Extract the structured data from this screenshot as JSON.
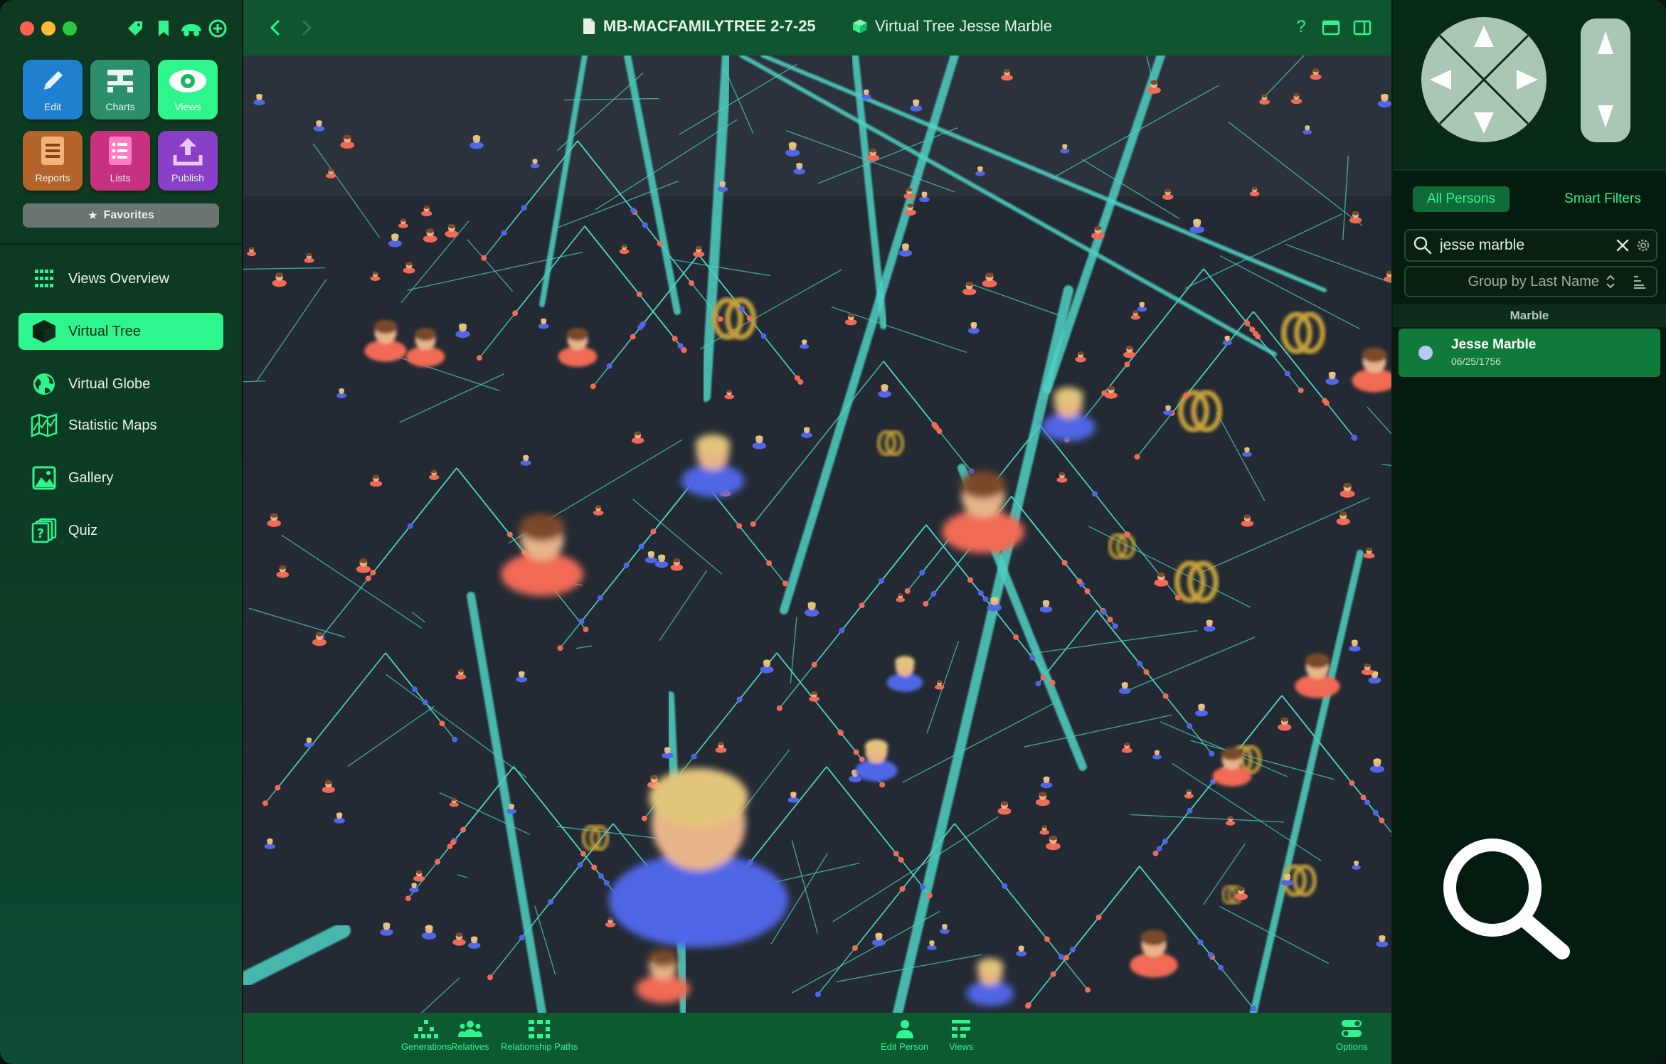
{
  "sidebar": {
    "tools": [
      {
        "label": "Edit",
        "icon": "pencil-icon",
        "color": "#1f7fd0"
      },
      {
        "label": "Charts",
        "icon": "charts-icon",
        "color": "#2b8f6b"
      },
      {
        "label": "Views",
        "icon": "eye-icon",
        "color": "#2ff58d"
      },
      {
        "label": "Reports",
        "icon": "report-icon",
        "color": "#b3642a"
      },
      {
        "label": "Lists",
        "icon": "list-icon",
        "color": "#c7327f"
      },
      {
        "label": "Publish",
        "icon": "publish-icon",
        "color": "#8a3fc9"
      }
    ],
    "favorites_label": "Favorites",
    "nav": [
      {
        "label": "Views Overview",
        "icon": "grid-icon"
      },
      {
        "label": "Virtual Tree",
        "icon": "cube-icon",
        "active": true
      },
      {
        "label": "Virtual Globe",
        "icon": "globe-icon"
      },
      {
        "label": "Statistic Maps",
        "icon": "map-icon"
      },
      {
        "label": "Gallery",
        "icon": "gallery-icon"
      },
      {
        "label": "Quiz",
        "icon": "quiz-icon"
      }
    ]
  },
  "titlebar": {
    "document": "MB-MACFAMILYTREE 2-7-25",
    "view": "Virtual Tree Jesse Marble",
    "help": "?"
  },
  "bottombar": {
    "items": [
      {
        "label": "Generations",
        "icon": "generations-icon"
      },
      {
        "label": "Relatives",
        "icon": "relatives-icon"
      },
      {
        "label": "Relationship Paths",
        "icon": "relationship-paths-icon"
      },
      {
        "label": "Edit Person",
        "icon": "edit-person-icon"
      },
      {
        "label": "Views",
        "icon": "views-icon"
      },
      {
        "label": "Options",
        "icon": "options-icon"
      }
    ]
  },
  "rightpanel": {
    "tabs": {
      "all": "All Persons",
      "smart": "Smart Filters"
    },
    "search": {
      "value": "jesse marble"
    },
    "group_by": "Group by Last Name",
    "section": "Marble",
    "results": [
      {
        "name": "Jesse Marble",
        "date": "06/25/1756"
      }
    ]
  },
  "colors": {
    "accent": "#2ff58d",
    "female": "#f06a55",
    "male": "#4f66e6",
    "line": "#4fd1c5",
    "ring": "#c9a23a"
  }
}
